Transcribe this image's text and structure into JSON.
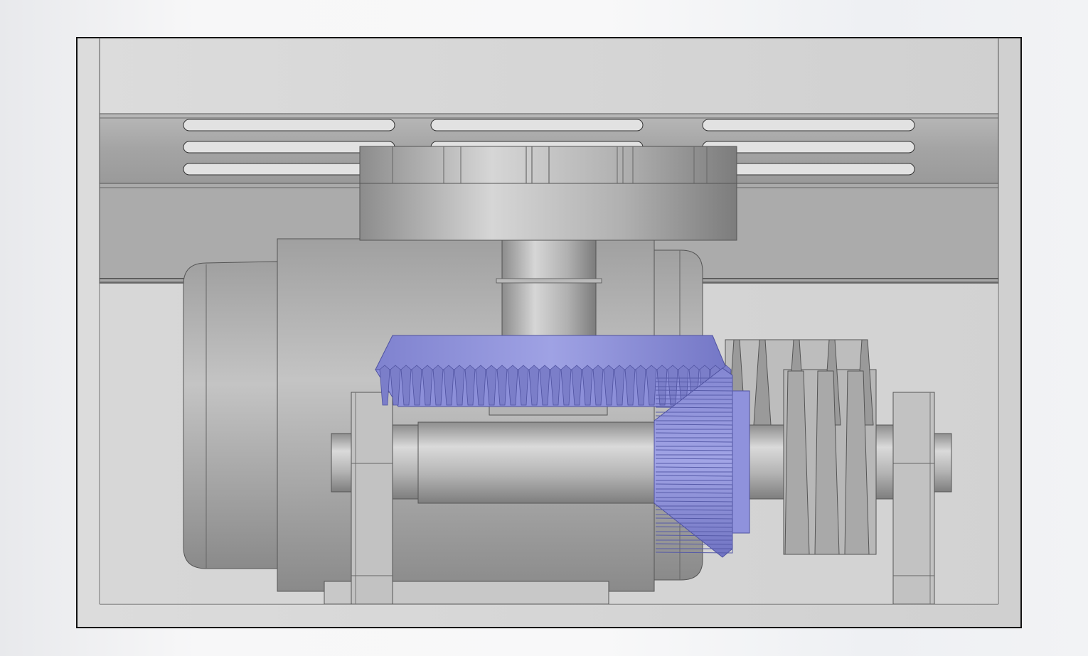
{
  "scene": {
    "kind": "cad-assembly-view",
    "components": [
      {
        "id": "housing",
        "icon": "enclosure-icon"
      },
      {
        "id": "top-vent-plate",
        "icon": "vent-slots-icon"
      },
      {
        "id": "motor",
        "icon": "motor-icon"
      },
      {
        "id": "vertical-shaft",
        "icon": "shaft-icon"
      },
      {
        "id": "horizontal-shaft",
        "icon": "shaft-icon"
      },
      {
        "id": "bevel-gear-large",
        "icon": "bevel-gear-icon"
      },
      {
        "id": "bevel-gear-pinion",
        "icon": "bevel-gear-icon"
      },
      {
        "id": "pulley-stack",
        "icon": "pulley-icon"
      },
      {
        "id": "bearing-left",
        "icon": "bearing-block-icon"
      },
      {
        "id": "bearing-right",
        "icon": "bearing-block-icon"
      }
    ]
  },
  "colors": {
    "background": "#f5f5f6",
    "housing": "#d8d8d8",
    "housing_edge": "#111111",
    "metal_light": "#d4d4d4",
    "metal_mid": "#a8a8a8",
    "metal_dark": "#7a7a7a",
    "gear": "#9598dc",
    "gear_dark": "#6c6fb8"
  }
}
